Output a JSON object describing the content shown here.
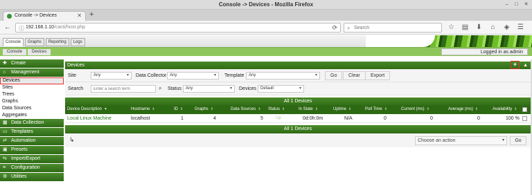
{
  "window": {
    "title": "Console -> Devices - Mozilla Firefox"
  },
  "browser": {
    "tab_title": "Console -> Devices",
    "url_host": "192.168.1.10",
    "url_path": "/cacti/host.php",
    "search_placeholder": "Search"
  },
  "cacti": {
    "tabs": [
      "Console",
      "Graphs",
      "Reporting",
      "Logs"
    ],
    "breadcrumbs": [
      "Console",
      "Devices"
    ],
    "login_text": "Logged in as admin"
  },
  "sidebar": {
    "create": "Create",
    "management": "Management",
    "management_items": [
      "Devices",
      "Sites",
      "Trees",
      "Graphs",
      "Data Sources",
      "Aggregates"
    ],
    "sections": [
      "Data Collection",
      "Templates",
      "Automation",
      "Presets",
      "Import/Export",
      "Configuration",
      "Utilities"
    ]
  },
  "panel": {
    "title": "Devices",
    "add_label": "+",
    "collapse_label": "▲"
  },
  "filters": {
    "site_label": "Site",
    "site_value": "Any",
    "collector_label": "Data Collector",
    "collector_value": "Any",
    "template_label": "Template",
    "template_value": "Any",
    "go": "Go",
    "clear": "Clear",
    "export": "Export",
    "search_label": "Search",
    "search_placeholder": "Enter a search term",
    "status_label": "Status",
    "status_value": "Any",
    "devices_label": "Devices",
    "devices_value": "Default"
  },
  "table": {
    "band_top": "All 1 Devices",
    "band_bottom": "All 1 Devices",
    "columns": [
      "Device Description",
      "Hostname",
      "ID",
      "Graphs",
      "Data Sources",
      "Status",
      "In State",
      "Uptime",
      "Poll Time",
      "Current (ms)",
      "Average (ms)",
      "Availability"
    ],
    "rows": [
      {
        "description": "Local Linux Machine",
        "hostname": "localhost",
        "id": "1",
        "graphs": "4",
        "data_sources": "5",
        "status": "Up",
        "in_state": "0d:0h:0m",
        "uptime": "N/A",
        "poll_time": "0",
        "current": "0",
        "average": "0",
        "availability": "100 %"
      }
    ]
  },
  "footer": {
    "action_placeholder": "Choose an action",
    "go": "Go"
  },
  "colors": {
    "accent_green": "#2f6b14",
    "highlight_red": "#e53030",
    "link_green": "#217a12"
  }
}
